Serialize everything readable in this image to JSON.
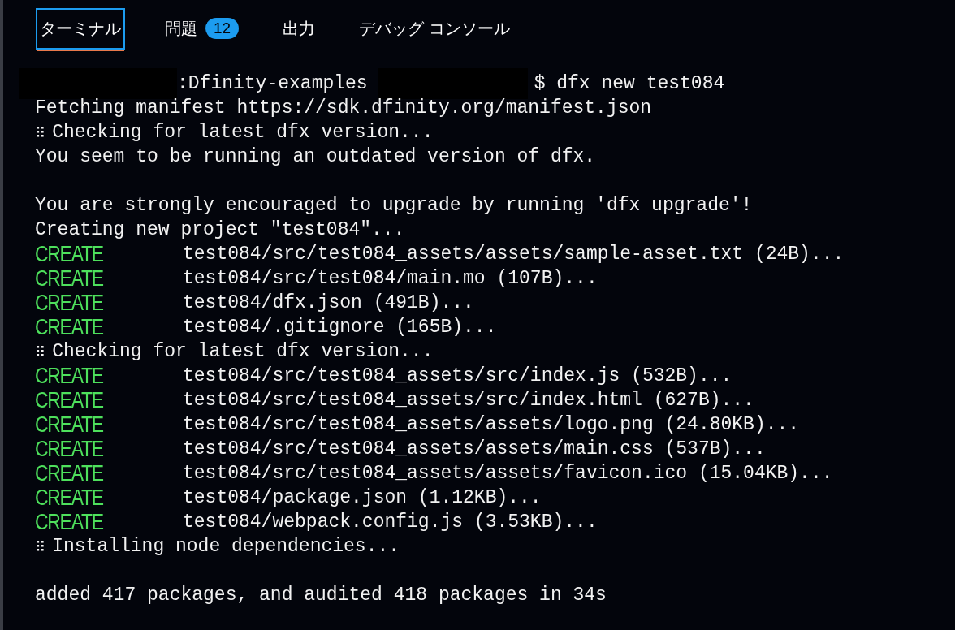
{
  "tabs": [
    {
      "label": "ターミナル",
      "selected": true
    },
    {
      "label": "問題",
      "selected": false,
      "badge": "12"
    },
    {
      "label": "出力",
      "selected": false
    },
    {
      "label": "デバッグ コンソール",
      "selected": false
    }
  ],
  "terminal": {
    "lines": [
      {
        "kind": "prompt",
        "path": ":Dfinity-examples",
        "command": "$ dfx new test084"
      },
      {
        "kind": "text",
        "text": "Fetching manifest https://sdk.dfinity.org/manifest.json"
      },
      {
        "kind": "spinner",
        "spinner": "⠿",
        "text": "Checking for latest dfx version..."
      },
      {
        "kind": "text",
        "text": "You seem to be running an outdated version of dfx."
      },
      {
        "kind": "blank"
      },
      {
        "kind": "text",
        "text": "You are strongly encouraged to upgrade by running 'dfx upgrade'!"
      },
      {
        "kind": "text",
        "text": "Creating new project \"test084\"..."
      },
      {
        "kind": "create",
        "action": "CREATE",
        "text": "test084/src/test084_assets/assets/sample-asset.txt (24B)..."
      },
      {
        "kind": "create",
        "action": "CREATE",
        "text": "test084/src/test084/main.mo (107B)..."
      },
      {
        "kind": "create",
        "action": "CREATE",
        "text": "test084/dfx.json (491B)..."
      },
      {
        "kind": "create",
        "action": "CREATE",
        "text": "test084/.gitignore (165B)..."
      },
      {
        "kind": "spinner",
        "spinner": "⠿",
        "text": "Checking for latest dfx version..."
      },
      {
        "kind": "create",
        "action": "CREATE",
        "text": "test084/src/test084_assets/src/index.js (532B)..."
      },
      {
        "kind": "create",
        "action": "CREATE",
        "text": "test084/src/test084_assets/src/index.html (627B)..."
      },
      {
        "kind": "create",
        "action": "CREATE",
        "text": "test084/src/test084_assets/assets/logo.png (24.80KB)..."
      },
      {
        "kind": "create",
        "action": "CREATE",
        "text": "test084/src/test084_assets/assets/main.css (537B)..."
      },
      {
        "kind": "create",
        "action": "CREATE",
        "text": "test084/src/test084_assets/assets/favicon.ico (15.04KB)..."
      },
      {
        "kind": "create",
        "action": "CREATE",
        "text": "test084/package.json (1.12KB)..."
      },
      {
        "kind": "create",
        "action": "CREATE",
        "text": "test084/webpack.config.js (3.53KB)..."
      },
      {
        "kind": "spinner",
        "spinner": "⠿",
        "text": "Installing node dependencies..."
      },
      {
        "kind": "blank"
      },
      {
        "kind": "text",
        "text": "added 417 packages, and audited 418 packages in 34s"
      }
    ]
  }
}
